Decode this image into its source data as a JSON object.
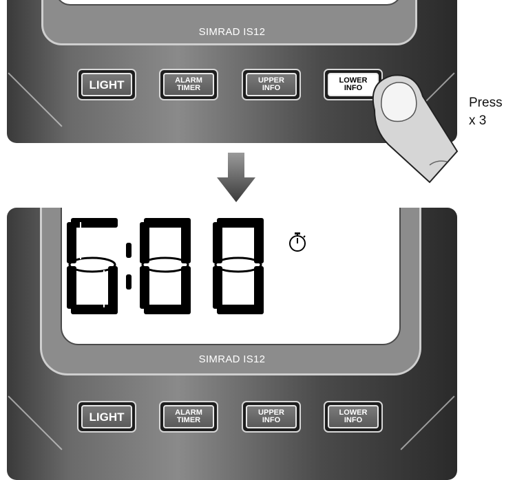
{
  "device": {
    "model_label": "SIMRAD IS12"
  },
  "buttons": {
    "light": "LIGHT",
    "alarm_timer": "ALARM\nTIMER",
    "upper_info": "UPPER\nINFO",
    "lower_info": "LOWER\nINFO"
  },
  "instruction": {
    "text": "Press\nx 3"
  },
  "display": {
    "readout": "6:00",
    "icon": "stopwatch-icon"
  },
  "colors": {
    "panel_dark": "#2a2a2a",
    "panel_light": "#8a8a8a",
    "button_face": "#6a6a6a",
    "active_button": "#ffffff",
    "segment": "#000000"
  },
  "icons": [
    "down-arrow-icon",
    "finger-icon",
    "stopwatch-icon"
  ]
}
